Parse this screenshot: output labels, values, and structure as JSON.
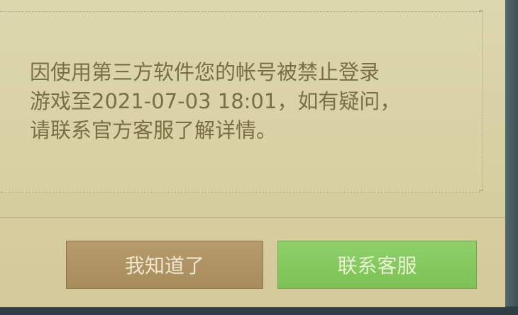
{
  "dialog": {
    "message_lines": [
      "因使用第三方软件您的帐号被禁止登录",
      "游戏至2021-07-03 18:01，如有疑问，",
      "请联系官方客服了解详情。"
    ],
    "buttons": {
      "ok_label": "我知道了",
      "contact_label": "联系客服"
    }
  },
  "colors": {
    "dialog_background": "#d9d1a4",
    "message_text": "#7a6f44",
    "ok_button": "#b09463",
    "contact_button": "#86c95f"
  }
}
